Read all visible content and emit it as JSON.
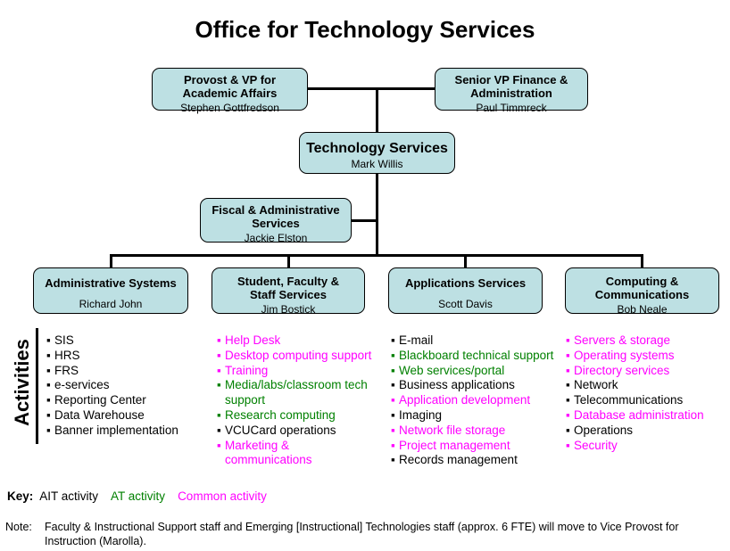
{
  "page": {
    "title": "Office for Technology Services"
  },
  "org": {
    "boxes": [
      {
        "id": "provost-vp-academic-affairs",
        "title": "Provost & VP for\nAcademic Affairs",
        "person": "Stephen Gottfredson"
      },
      {
        "id": "senior-vp-finance-administration",
        "title": "Senior VP Finance &\nAdministration",
        "person": "Paul Timmreck"
      },
      {
        "id": "technology-services",
        "title": "Technology Services",
        "person": "Mark Willis"
      },
      {
        "id": "fiscal-administrative-services",
        "title": "Fiscal & Administrative\nServices",
        "person": "Jackie Elston"
      },
      {
        "id": "administrative-systems",
        "title": "Administrative Systems",
        "person": "Richard John"
      },
      {
        "id": "student-faculty-staff-services",
        "title": "Student, Faculty &\nStaff Services",
        "person": "Jim Bostick"
      },
      {
        "id": "applications-services",
        "title": "Applications Services",
        "person": "Scott Davis"
      },
      {
        "id": "computing-communications",
        "title": "Computing &\nCommunications",
        "person": "Bob Neale"
      }
    ]
  },
  "activities": {
    "section_label": "Activities",
    "columns": [
      {
        "id": "administrative-systems-activities",
        "items": [
          {
            "text": "SIS",
            "color": "black"
          },
          {
            "text": "HRS",
            "color": "black"
          },
          {
            "text": "FRS",
            "color": "black"
          },
          {
            "text": "e-services",
            "color": "black"
          },
          {
            "text": "Reporting Center",
            "color": "black"
          },
          {
            "text": "Data Warehouse",
            "color": "black"
          },
          {
            "text": "Banner implementation",
            "color": "black"
          }
        ]
      },
      {
        "id": "student-faculty-staff-services-activities",
        "items": [
          {
            "text": "Help Desk",
            "color": "magenta"
          },
          {
            "text": "Desktop computing support",
            "color": "magenta"
          },
          {
            "text": "Training",
            "color": "magenta"
          },
          {
            "text": "Media/labs/classroom tech support",
            "color": "green"
          },
          {
            "text": "Research computing",
            "color": "green"
          },
          {
            "text": "VCUCard operations",
            "color": "black"
          },
          {
            "text": "Marketing & communications",
            "color": "magenta"
          }
        ]
      },
      {
        "id": "applications-services-activities",
        "items": [
          {
            "text": "E-mail",
            "color": "black"
          },
          {
            "text": "Blackboard  technical support",
            "color": "green"
          },
          {
            "text": "Web services/portal",
            "color": "green"
          },
          {
            "text": "Business applications",
            "color": "black"
          },
          {
            "text": "Application development",
            "color": "magenta"
          },
          {
            "text": "Imaging",
            "color": "black"
          },
          {
            "text": "Network file storage",
            "color": "magenta"
          },
          {
            "text": "Project management",
            "color": "magenta"
          },
          {
            "text": "Records management",
            "color": "black"
          }
        ]
      },
      {
        "id": "computing-communications-activities",
        "items": [
          {
            "text": "Servers & storage",
            "color": "magenta"
          },
          {
            "text": "Operating systems",
            "color": "magenta"
          },
          {
            "text": "Directory services",
            "color": "magenta"
          },
          {
            "text": "Network",
            "color": "black"
          },
          {
            "text": "Telecommunications",
            "color": "black"
          },
          {
            "text": "Database administration",
            "color": "magenta"
          },
          {
            "text": "Operations",
            "color": "black"
          },
          {
            "text": "Security",
            "color": "magenta"
          }
        ]
      }
    ]
  },
  "key": {
    "label": "Key:",
    "entries": [
      {
        "text": "AIT activity",
        "color": "black"
      },
      {
        "text": "AT activity",
        "color": "green"
      },
      {
        "text": "Common activity",
        "color": "magenta"
      }
    ]
  },
  "note": {
    "label": "Note:",
    "text": "Faculty & Instructional Support staff and Emerging [Instructional] Technologies staff (approx. 6 FTE) will move to Vice Provost for Instruction (Marolla)."
  },
  "colors": {
    "box_fill": "#bde0e3",
    "box_border": "#000000",
    "ait_activity": "#000000",
    "at_activity": "#008000",
    "common_activity": "#ff00ff",
    "background": "#ffffff"
  }
}
